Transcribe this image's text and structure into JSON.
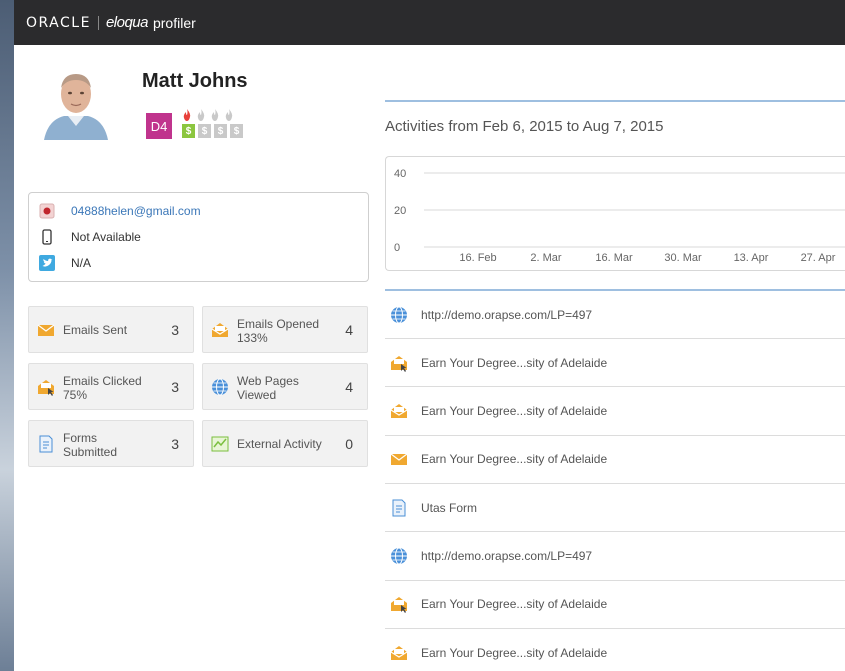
{
  "header": {
    "oracle": "ORACLE",
    "eloqua": "eloqua",
    "product": "profiler"
  },
  "profile": {
    "name": "Matt Johns",
    "lead_score": "D4",
    "flames_active": 1,
    "flames_total": 4,
    "dollars_active": 1,
    "dollars_total": 4
  },
  "contact": {
    "email": "04888helen@gmail.com",
    "phone": "Not Available",
    "twitter": "N/A"
  },
  "stats": [
    {
      "label": "Emails Sent",
      "sub": "",
      "value": "3",
      "icon": "email-envelope-icon"
    },
    {
      "label": "Emails Opened",
      "sub": "133%",
      "value": "4",
      "icon": "email-open-icon"
    },
    {
      "label": "Emails Clicked",
      "sub": "75%",
      "value": "3",
      "icon": "email-click-icon"
    },
    {
      "label": "Web Pages",
      "sub": "Viewed",
      "value": "4",
      "icon": "globe-icon"
    },
    {
      "label": "Forms",
      "sub": "Submitted",
      "value": "3",
      "icon": "form-icon"
    },
    {
      "label": "External Activity",
      "sub": "",
      "value": "0",
      "icon": "external-activity-icon"
    }
  ],
  "activities": {
    "title": "Activities from Feb 6, 2015 to Aug 7, 2015",
    "items": [
      {
        "text": "http://demo.orapse.com/LP=497",
        "icon": "globe-icon"
      },
      {
        "text": "Earn Your Degree...sity of Adelaide",
        "icon": "email-click-icon"
      },
      {
        "text": "Earn Your Degree...sity of Adelaide",
        "icon": "email-open-icon"
      },
      {
        "text": "Earn Your Degree...sity of Adelaide",
        "icon": "email-envelope-icon"
      },
      {
        "text": "Utas Form",
        "icon": "form-icon"
      },
      {
        "text": "http://demo.orapse.com/LP=497",
        "icon": "globe-icon"
      },
      {
        "text": "Earn Your Degree...sity of Adelaide",
        "icon": "email-click-icon"
      },
      {
        "text": "Earn Your Degree...sity of Adelaide",
        "icon": "email-open-icon"
      }
    ]
  },
  "chart_data": {
    "type": "line",
    "y_ticks": [
      "40",
      "20",
      "0"
    ],
    "ylim": [
      0,
      40
    ],
    "x_ticks": [
      "16. Feb",
      "2. Mar",
      "16. Mar",
      "30. Mar",
      "13. Apr",
      "27. Apr"
    ],
    "grid": true
  },
  "colors": {
    "topbar": "#2b2b2d",
    "lead_score": "#c0348d",
    "email_orange": "#f0a830",
    "link_blue": "#3b77b8",
    "accent_line": "#9ebfe0"
  }
}
